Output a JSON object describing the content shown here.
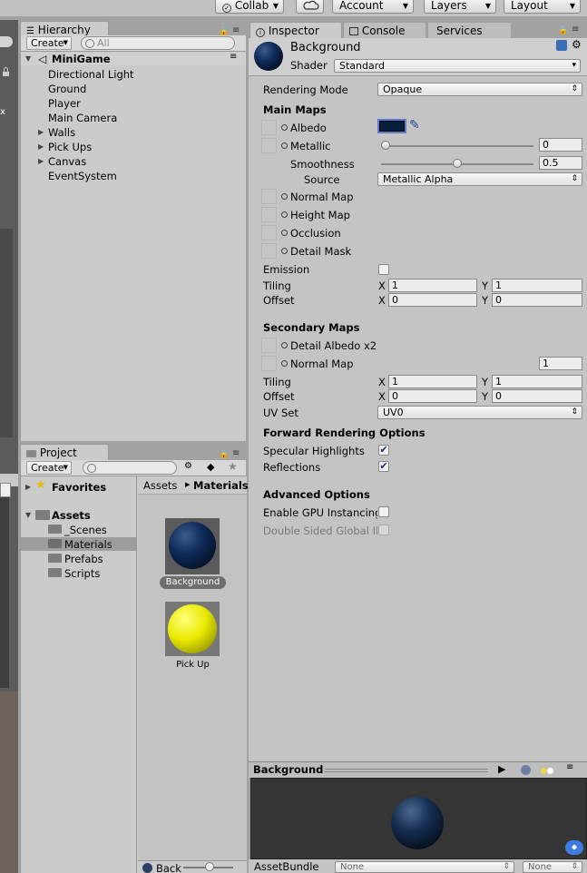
{
  "toolbar": {
    "collab": "Collab",
    "account": "Account",
    "layers": "Layers",
    "layout": "Layout"
  },
  "hierarchy": {
    "tab": "Hierarchy",
    "create": "Create",
    "search_placeholder": "All",
    "scene": "MiniGame",
    "items": [
      "Directional Light",
      "Ground",
      "Player",
      "Main Camera",
      "Walls",
      "Pick Ups",
      "Canvas",
      "EventSystem"
    ]
  },
  "project": {
    "tab": "Project",
    "create": "Create",
    "favorites": "Favorites",
    "assets": "Assets",
    "folders": [
      "_Scenes",
      "Materials",
      "Prefabs",
      "Scripts"
    ],
    "breadcrumb_root": "Assets",
    "breadcrumb_current": "Materials",
    "grid_items": [
      "Background",
      "Pick Up"
    ],
    "bottom_label": "Back"
  },
  "inspector": {
    "tab": "Inspector",
    "console_tab": "Console",
    "services_tab": "Services",
    "material_name": "Background",
    "shader_label": "Shader",
    "shader_value": "Standard",
    "rendering_mode_label": "Rendering Mode",
    "rendering_mode_value": "Opaque",
    "main_maps": "Main Maps",
    "albedo": "Albedo",
    "metallic": "Metallic",
    "metallic_value": "0",
    "smoothness": "Smoothness",
    "smoothness_value": "0.5",
    "source": "Source",
    "source_value": "Metallic Alpha",
    "normal_map": "Normal Map",
    "height_map": "Height Map",
    "occlusion": "Occlusion",
    "detail_mask": "Detail Mask",
    "emission": "Emission",
    "tiling": "Tiling",
    "offset": "Offset",
    "x": "X",
    "y": "Y",
    "tiling_x": "1",
    "tiling_y": "1",
    "offset_x": "0",
    "offset_y": "0",
    "secondary_maps": "Secondary Maps",
    "detail_albedo": "Detail Albedo x2",
    "sec_normal_map": "Normal Map",
    "sec_normal_value": "1",
    "sec_tiling_x": "1",
    "sec_tiling_y": "1",
    "sec_offset_x": "0",
    "sec_offset_y": "0",
    "uv_set": "UV Set",
    "uv_set_value": "UV0",
    "forward_rendering": "Forward Rendering Options",
    "specular_highlights": "Specular Highlights",
    "reflections": "Reflections",
    "advanced": "Advanced Options",
    "gpu_instancing": "Enable GPU Instancing",
    "double_sided": "Double Sided Global Illumination",
    "preview_title": "Background",
    "asset_bundle": "AssetBundle",
    "asset_bundle_value": "None",
    "asset_variant_value": "None",
    "metallic_level": 0.0,
    "smoothness_level": 0.5,
    "albedo_color": "#0a1f3e",
    "specular_checked": true,
    "reflections_checked": true
  }
}
